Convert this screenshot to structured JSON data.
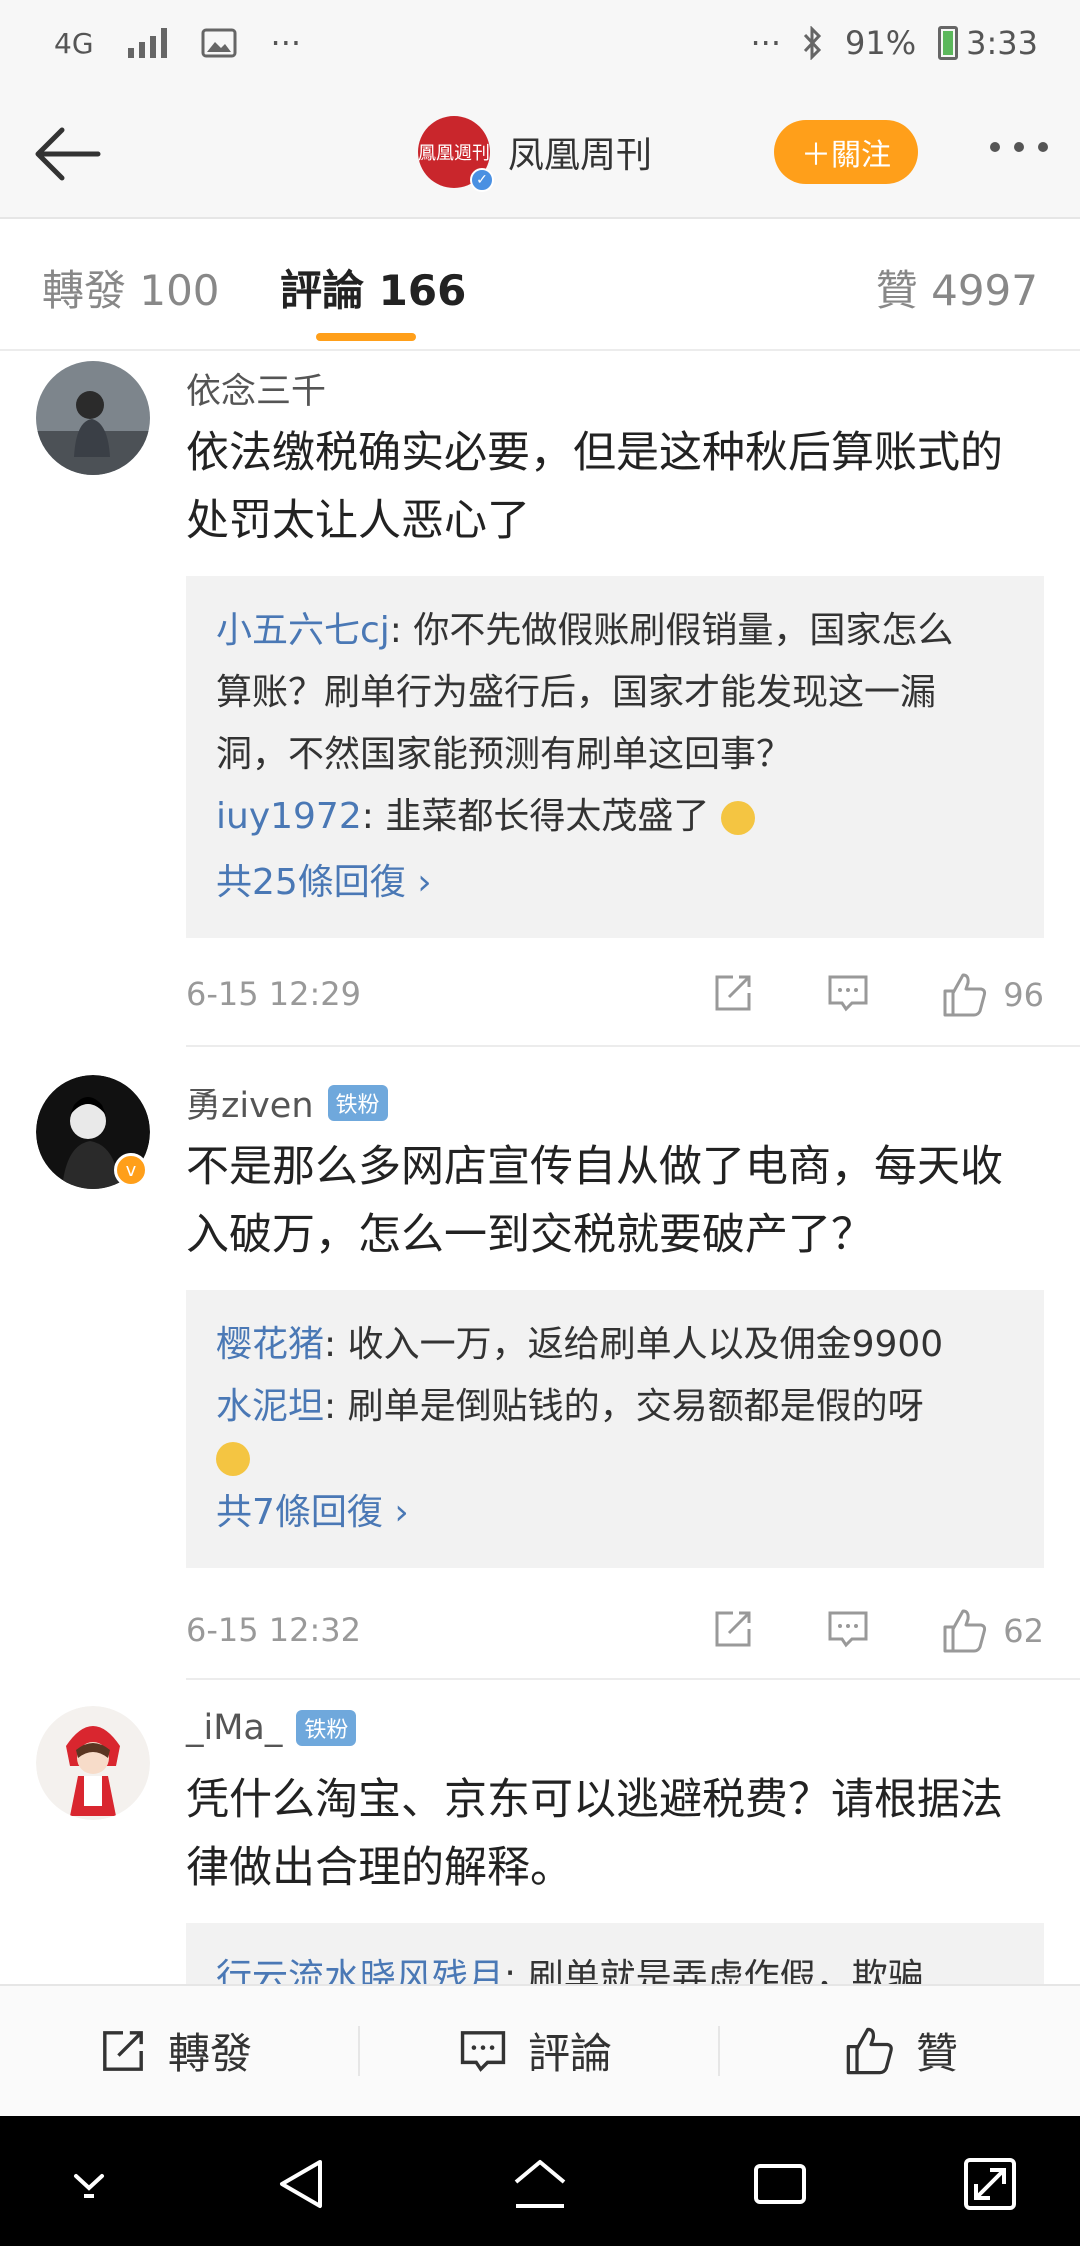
{
  "status_bar": {
    "network": "4G",
    "dots_left": "···",
    "dots_right": "···",
    "battery": "91%",
    "time": "3:33"
  },
  "header": {
    "account_name": "凤凰周刊",
    "brand_logo_text": "鳳凰週刊",
    "follow_label": "＋關注"
  },
  "tabs": {
    "repost": "轉發 100",
    "comments": "評論 166",
    "likes": "贊 4997"
  },
  "comments": [
    {
      "username": "依念三千",
      "badge": "",
      "text_line1": "依法缴税确实必要，但是这种秋后算账式的",
      "text_line2": "处罚太让人恶心了",
      "replies": [
        {
          "user": "小五六七cj",
          "text_line1": ": 你不先做假账刷假销量，国家怎么",
          "text_line2": "算账？刷单行为盛行后，国家才能发现这一漏",
          "text_line3": "洞，不然国家能预测有刷单这回事？"
        },
        {
          "user": "iuy1972",
          "text_line1": ": 韭菜都长得太茂盛了"
        }
      ],
      "more_replies": "共25條回復 ›",
      "time": "6-15 12:29",
      "likes": "96"
    },
    {
      "username": "勇ziven",
      "badge": "铁粉",
      "text_line1": "不是那么多网店宣传自从做了电商，每天收",
      "text_line2": "入破万，怎么一到交税就要破产了？",
      "replies": [
        {
          "user": "樱花猪",
          "text_line1": ": 收入一万，返给刷单人以及佣金9900"
        },
        {
          "user": "水泥坦",
          "text_line1": ": 刷单是倒贴钱的，交易额都是假的呀"
        }
      ],
      "more_replies": "共7條回復 ›",
      "time": "6-15 12:32",
      "likes": "62"
    },
    {
      "username": "_iMa_",
      "badge": "铁粉",
      "text_line1": "凭什么淘宝、京东可以逃避税费？请根据法",
      "text_line2": "律做出合理的解释。",
      "replies": [
        {
          "user": "行云流水晓风残月",
          "text_line1": ": 刷单就是弄虚作假，欺骗"
        }
      ]
    }
  ],
  "bottom_bar": {
    "repost": "轉發",
    "comment": "評論",
    "like": "贊"
  },
  "colors": {
    "accent_orange": "#ff9f1a",
    "link_blue": "#4a78b5",
    "brand_red": "#c9262c"
  }
}
